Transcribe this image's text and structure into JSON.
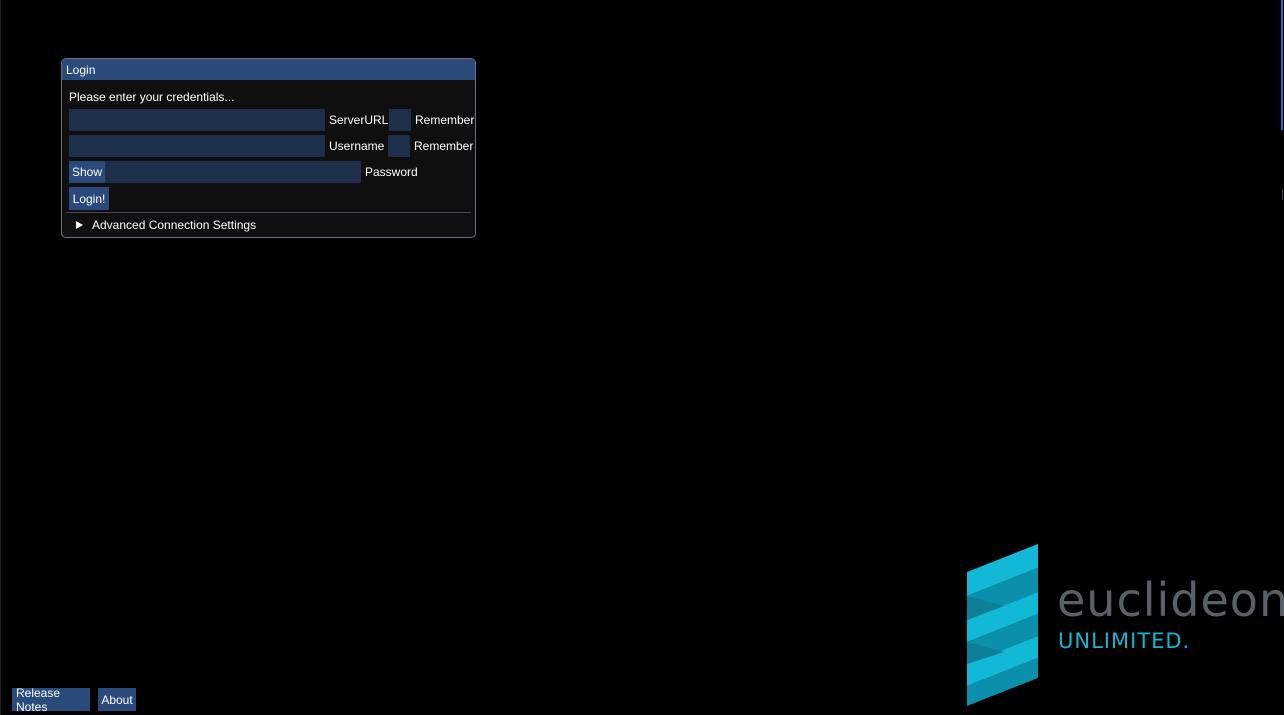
{
  "login": {
    "title": "Login",
    "prompt": "Please enter your credentials...",
    "server_url": {
      "value": "",
      "label": "ServerURL",
      "remember_label": "Remember",
      "remember_checked": false
    },
    "username": {
      "value": "",
      "label": "Username",
      "remember_label": "Remember",
      "remember_checked": false
    },
    "password": {
      "show_label": "Show",
      "value": "",
      "label": "Password"
    },
    "login_button": "Login!",
    "advanced_settings": {
      "label": "Advanced Connection Settings",
      "expanded": false
    }
  },
  "footer": {
    "release_notes": "Release Notes",
    "about": "About"
  },
  "logo": {
    "wordmark": "euclideon",
    "tagline": "UNLIMITED.",
    "icon": "euclideon-ribbon-logo-icon"
  },
  "colors": {
    "background": "#000000",
    "window_bg": "#0f0f0f",
    "titlebar": "#294a7a",
    "field_bg": "#1d2f4b",
    "button_bg": "#294a7a",
    "logo_cyan": "#1ab3d0",
    "logo_grey": "#5a6068"
  }
}
